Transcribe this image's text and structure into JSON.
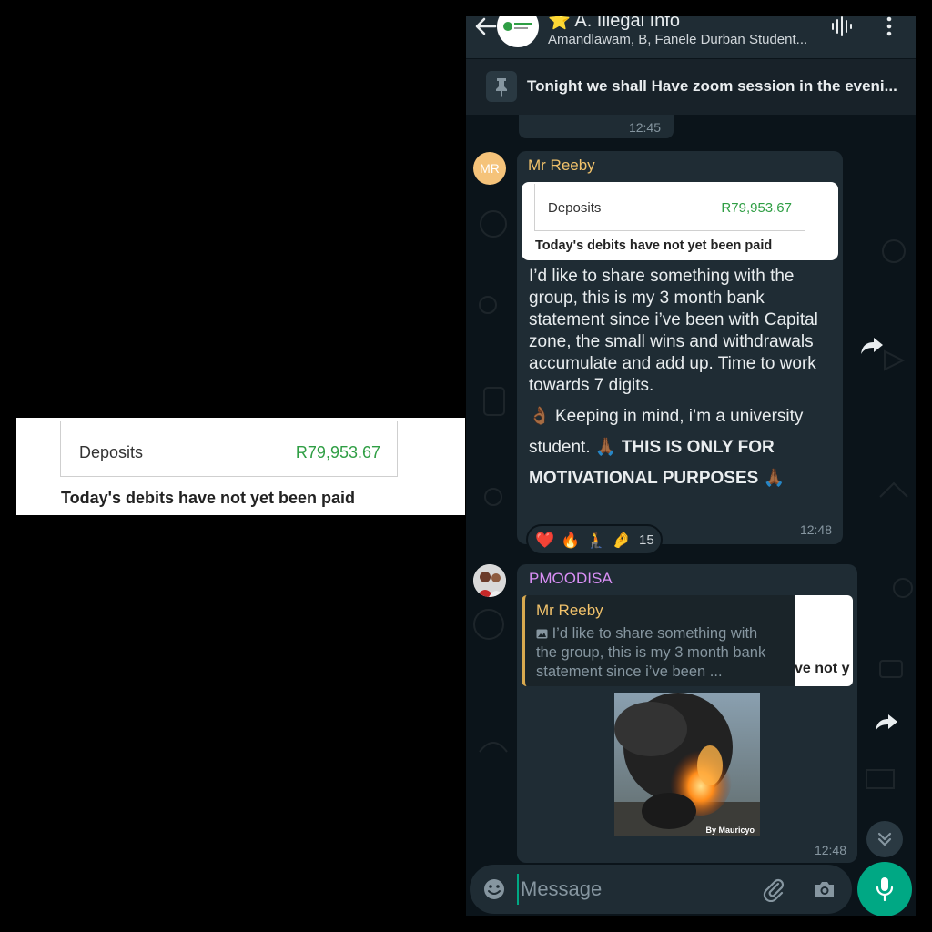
{
  "crop": {
    "deposits_label": "Deposits",
    "deposits_value": "R79,953.67",
    "debits_text": "Today's debits have not yet been paid"
  },
  "header": {
    "title": "⭐ A. Illegal Info",
    "subtitle": "Amandlawam, B, Fanele Durban Student...",
    "avatar_text": "CAPITAL ZONE"
  },
  "pinned": {
    "text": "Tonight we shall Have zoom session in the eveni..."
  },
  "chat": {
    "time_pill": "12:45",
    "message1": {
      "avatar_initials": "MR",
      "sender": "Mr Reeby",
      "image_deposits_label": "Deposits",
      "image_deposits_value": "R79,953.67",
      "image_debits": "Today's debits have not yet been paid",
      "text": "I’d like to share something with the group, this is my 3 month bank statement since i’ve been with Capital zone, the small wins and withdrawals accumulate and add up. Time to work towards 7 digits.",
      "emoji1": "👌🏾",
      "text2": "Keeping in mind, i’m a university student.",
      "emoji2": "🙏🏾",
      "bold_text": "THIS IS ONLY FOR MOTIVATIONAL PURPOSES",
      "emoji3": "🙏🏾",
      "time": "12:48",
      "reactions": [
        "❤️",
        "🔥",
        "🧎",
        "🤌"
      ],
      "reaction_count": "15"
    },
    "message2": {
      "sender": "PMOODISA",
      "quote_sender": "Mr Reeby",
      "quote_text": "I’d like to share something with the group, this is my 3 month bank statement since i’ve been ...",
      "quote_thumb_text": "ve not y",
      "image_watermark": "By Mauricyo",
      "time": "12:48"
    }
  },
  "input": {
    "placeholder": "Message"
  },
  "colors": {
    "accent": "#00a884",
    "bubble": "#1f2c34",
    "background": "#0b141a",
    "sender1": "#f1c26b",
    "sender2": "#d98ff5",
    "deposit_green": "#2f9e44"
  }
}
